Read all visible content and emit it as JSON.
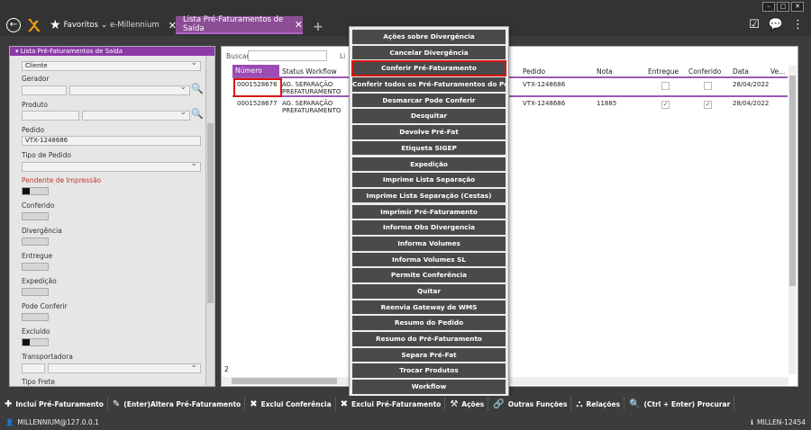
{
  "topbar": {
    "favorites_label": "Favoritos",
    "tabs": [
      {
        "label": "e-Millennium"
      },
      {
        "label": "Lista Pré-Faturamentos de Saída"
      }
    ]
  },
  "filter_panel": {
    "title": "Lista Pré-Faturamentos de Saída",
    "cliente_value": "Cliente",
    "gerador_label": "Gerador",
    "produto_label": "Produto",
    "pedido_label": "Pedido",
    "pedido_value": "VTX-1248686",
    "tipo_pedido_label": "Tipo de Pedido",
    "pendente_label": "Pendente de Impressão",
    "conferido_label": "Conferido",
    "divergencia_label": "Divergência",
    "entregue_label": "Entregue",
    "expedicao_label": "Expedição",
    "pode_conferir_label": "Pode Conferir",
    "excluido_label": "Excluído",
    "transportadora_label": "Transportadora",
    "tipo_frete_label": "Tipo Frete"
  },
  "grid": {
    "search_label": "Buscar",
    "limit_label": "Li",
    "columns": [
      "Número",
      "Status Workflow",
      "Pedido",
      "Nota",
      "Entregue",
      "Conferido",
      "Data",
      "Ve..."
    ],
    "rows": [
      {
        "numero": "0001528676",
        "status1": "AG. SEPARAÇÃO",
        "status2": "PREFATURAMENTO",
        "pedido": "VTX-1248686",
        "nota": "",
        "data": "28/04/2022"
      },
      {
        "numero": "0001528677",
        "status1": "AG. SEPARAÇÃO",
        "status2": "PREFATURAMENTO",
        "pedido": "VTX-1248686",
        "nota": "11885",
        "data": "28/04/2022"
      }
    ],
    "count": "2"
  },
  "actions_menu": {
    "items": [
      "Ações sobre Divergência",
      "Cancelar Divergência",
      "Conferir Pré-Faturamento",
      "Conferir todos os Pré-Faturamentos do Pedido",
      "Desmarcar Pode Conferir",
      "Desquitar",
      "Devolve Pré-Fat",
      "Etiqueta SIGEP",
      "Expedição",
      "Imprime Lista Separação",
      "Imprime Lista Separação (Cestas)",
      "Imprimir Pré-Faturamento",
      "Informa Obs Divergencia",
      "Informa Volumes",
      "Informa Volumes SL",
      "Permite Conferência",
      "Quitar",
      "Reenvia Gateway de WMS",
      "Resumo do Pedido",
      "Resumo do Pré-Faturamento",
      "Separa Pré-Fat",
      "Trocar Produtos",
      "Workflow"
    ]
  },
  "toolbar": {
    "incluir": "Incluí Pré-Faturamento",
    "alterar": "(Enter)Altera Pré-Faturamento",
    "exclui_conf": "Exclui Conferência",
    "exclui_prefat": "Exclui Pré-Faturamento",
    "acoes": "Ações",
    "outras": "Outras Funções",
    "relacoes": "Relações",
    "procurar": "(Ctrl + Enter) Procurar"
  },
  "status": {
    "user": "MILLENNIUM@127.0.0.1",
    "id": "MILLEN-12454"
  }
}
